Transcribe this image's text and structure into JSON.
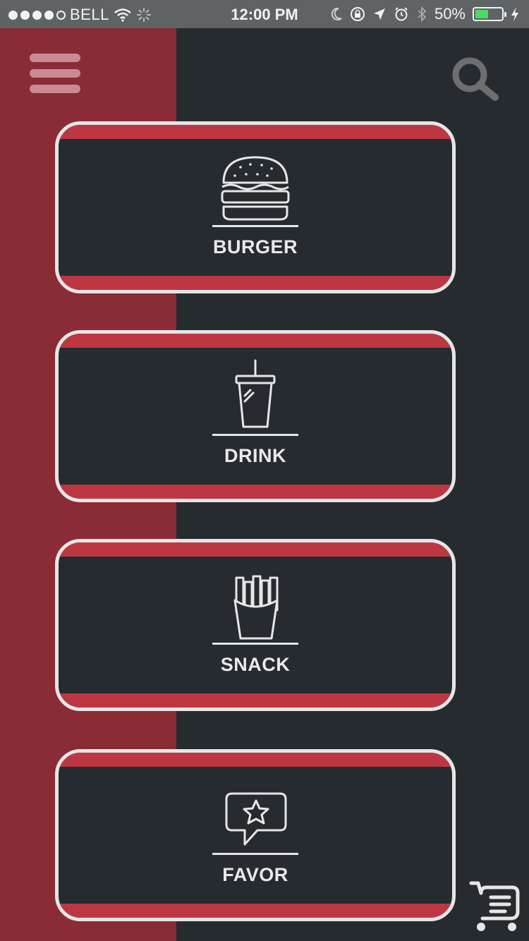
{
  "status_bar": {
    "carrier": "BELL",
    "time": "12:00 PM",
    "battery_percent_label": "50%",
    "battery_level": 0.5,
    "signal_bars": 4,
    "signal_total": 5
  },
  "colors": {
    "side_panel": "#8a2c35",
    "background": "#262b30",
    "card_stripe": "#bd3742",
    "card_border": "#e6e6e6",
    "menu_icon": "#cb8a91"
  },
  "header": {
    "menu_icon": "hamburger-menu-icon",
    "search_icon": "search-icon"
  },
  "categories": [
    {
      "label": "BURGER",
      "icon": "burger-icon"
    },
    {
      "label": "DRINK",
      "icon": "drink-cup-icon"
    },
    {
      "label": "SNACK",
      "icon": "fries-icon"
    },
    {
      "label": "FAVOR",
      "icon": "star-speech-bubble-icon"
    }
  ],
  "footer": {
    "cart_icon": "shopping-cart-icon"
  }
}
